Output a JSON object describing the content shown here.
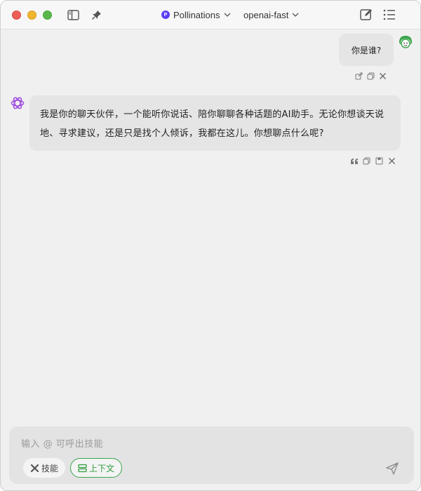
{
  "titlebar": {
    "provider": {
      "badge": "P",
      "label": "Pollinations"
    },
    "model": {
      "label": "openai-fast"
    }
  },
  "chat": {
    "user_message": "你是谁?",
    "assistant_message": "我是你的聊天伙伴，一个能听你说话、陪你聊聊各种话题的AI助手。无论你想谈天说地、寻求建议，还是只是找个人倾诉，我都在这儿。你想聊点什么呢?"
  },
  "composer": {
    "placeholder": "输入 @ 可呼出技能",
    "skill_chip": "技能",
    "context_chip": "上下文"
  },
  "colors": {
    "accent_green": "#3aa54b",
    "provider_badge": "#5b3df5",
    "assistant_icon": "#a050e0"
  }
}
